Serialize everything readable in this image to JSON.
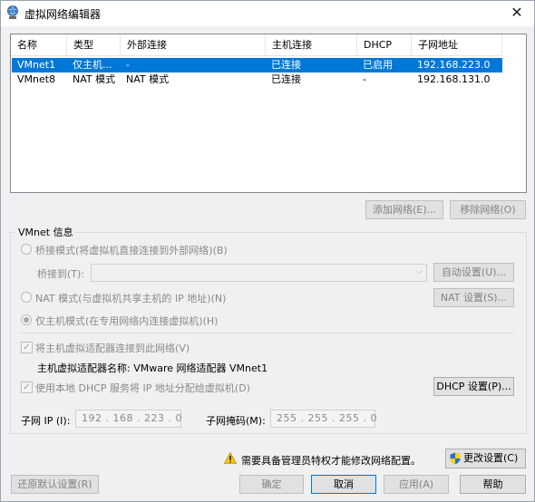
{
  "window": {
    "title": "虚拟网络编辑器",
    "close_glyph": "✕",
    "app_icon": "network-globe-icon"
  },
  "list": {
    "columns": [
      "名称",
      "类型",
      "外部连接",
      "主机连接",
      "DHCP",
      "子网地址"
    ],
    "rows": [
      {
        "name": "VMnet1",
        "type": "仅主机...",
        "external": "-",
        "host": "已连接",
        "dhcp": "已启用",
        "subnet": "192.168.223.0",
        "selected": true
      },
      {
        "name": "VMnet8",
        "type": "NAT 模式",
        "external": "NAT 模式",
        "host": "已连接",
        "dhcp": "-",
        "subnet": "192.168.131.0",
        "selected": false
      }
    ]
  },
  "list_buttons": {
    "add": "添加网络(E)...",
    "remove": "移除网络(O)"
  },
  "vmnet_info": {
    "group_title": "VMnet 信息",
    "bridged_label": "桥接模式(将虚拟机直接连接到外部网络)(B)",
    "bridged_to_label": "桥接到(T):",
    "bridged_to_value": "",
    "auto_settings": "自动设置(U)...",
    "nat_label": "NAT 模式(与虚拟机共享主机的 IP 地址)(N)",
    "nat_settings": "NAT 设置(S)...",
    "hostonly_label": "仅主机模式(在专用网络内连接虚拟机)(H)",
    "selected_mode": "hostonly",
    "connect_adapter_label": "将主机虚拟适配器连接到此网络(V)",
    "connect_adapter_checked": true,
    "adapter_name_label": "主机虚拟适配器名称: VMware 网络适配器 VMnet1",
    "use_dhcp_label": "使用本地 DHCP 服务将 IP 地址分配给虚拟机(D)",
    "use_dhcp_checked": true,
    "dhcp_settings": "DHCP 设置(P)...",
    "subnet_ip_label": "子网 IP (I):",
    "subnet_ip_value": "192 . 168 . 223 .  0",
    "subnet_mask_label": "子网掩码(M):",
    "subnet_mask_value": "255 . 255 . 255 .  0"
  },
  "admin_notice": {
    "text": "需要具备管理员特权才能修改网络配置。",
    "icon": "warning-icon",
    "change_settings": "更改设置(C)",
    "change_icon": "uac-shield-icon"
  },
  "footer": {
    "restore_defaults": "还原默认设置(R)",
    "ok": "确定",
    "cancel": "取消",
    "apply": "应用(A)",
    "help": "帮助"
  },
  "colors": {
    "selection": "#0078d7",
    "window_bg": "#f0f0f0",
    "warning": "#ffcc00"
  }
}
